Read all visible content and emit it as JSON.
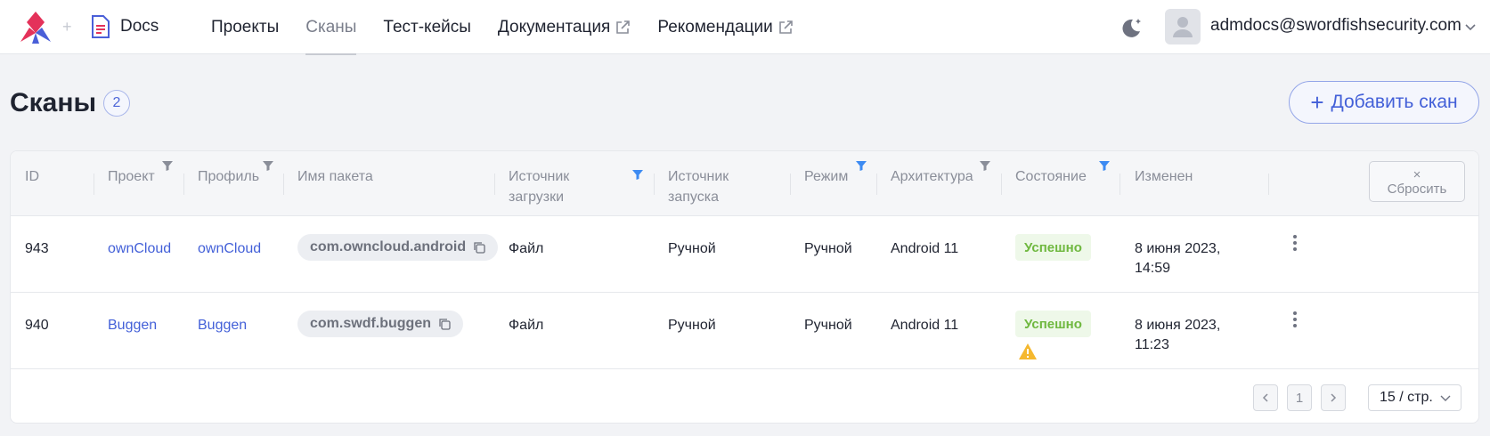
{
  "header": {
    "brand_label": "Docs",
    "nav": [
      {
        "label": "Проекты",
        "active": false,
        "external": false
      },
      {
        "label": "Сканы",
        "active": true,
        "external": false
      },
      {
        "label": "Тест-кейсы",
        "active": false,
        "external": false
      },
      {
        "label": "Документация",
        "active": false,
        "external": true
      },
      {
        "label": "Рекомендации",
        "active": false,
        "external": true
      }
    ],
    "user_email": "admdocs@swordfishsecurity.com",
    "icons": [
      "app-logo-icon",
      "docs-icon",
      "external-link-icon",
      "moon-icon",
      "avatar",
      "chevron-down-icon"
    ]
  },
  "page": {
    "title": "Сканы",
    "count": "2",
    "add_button_label": "Добавить скан"
  },
  "table": {
    "columns": {
      "id": "ID",
      "project": "Проект",
      "profile": "Профиль",
      "package": "Имя пакета",
      "upload_source_1": "Источник",
      "upload_source_2": "загрузки",
      "launch_source_1": "Источник",
      "launch_source_2": "запуска",
      "mode": "Режим",
      "arch": "Архитектура",
      "state": "Состояние",
      "changed": "Изменен"
    },
    "reset_x": "×",
    "reset_label": "Сбросить",
    "rows": [
      {
        "id": "943",
        "project": "ownCloud",
        "profile": "ownCloud",
        "package": "com.owncloud.android",
        "upload_source": "Файл",
        "launch_source": "Ручной",
        "mode": "Ручной",
        "arch": "Android 11",
        "state": "Успешно",
        "warning": false,
        "changed_1": "8 июня 2023,",
        "changed_2": "14:59"
      },
      {
        "id": "940",
        "project": "Buggen",
        "profile": "Buggen",
        "package": "com.swdf.buggen",
        "upload_source": "Файл",
        "launch_source": "Ручной",
        "mode": "Ручной",
        "arch": "Android 11",
        "state": "Успешно",
        "warning": true,
        "changed_1": "8 июня 2023,",
        "changed_2": "11:23"
      }
    ]
  },
  "pagination": {
    "current_page": "1",
    "page_size": "15 / стр."
  },
  "colors": {
    "accent": "#4360d8",
    "success_text": "#6fb83f",
    "success_bg": "#eef8e9",
    "warning": "#f5b82e",
    "filter_active": "#3d8bf2",
    "filter_inactive": "#8a8e99"
  }
}
